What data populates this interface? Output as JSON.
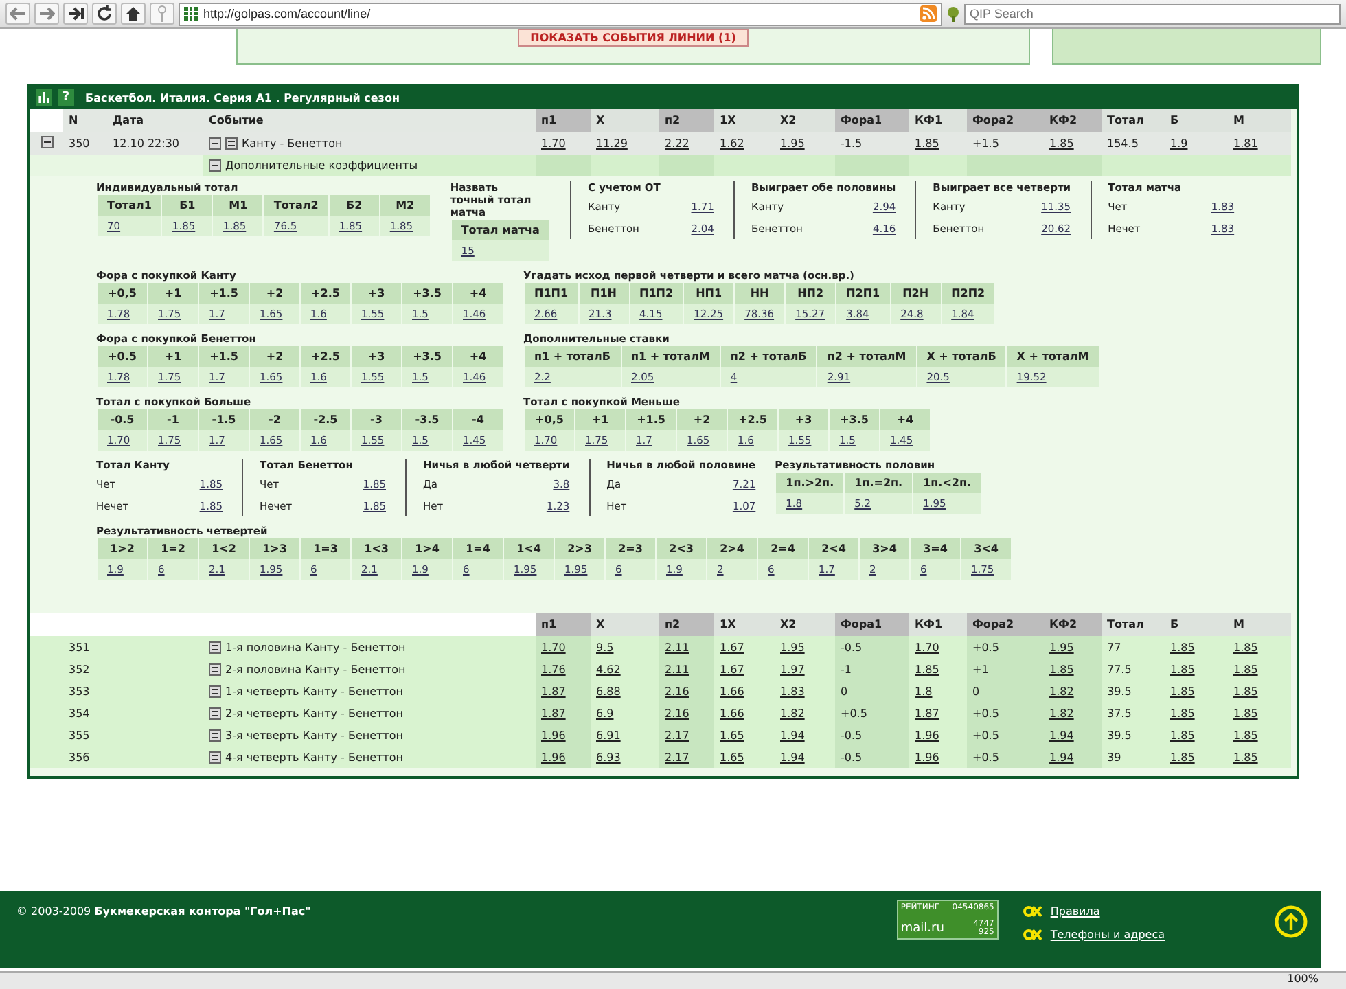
{
  "browser": {
    "url": "http://golpas.com/account/line/",
    "search_placeholder": "QIP Search",
    "zoom": "100%"
  },
  "banner": {
    "button": "ПОКАЗАТЬ СОБЫТИЯ ЛИНИИ (1)"
  },
  "panel": {
    "help": "?",
    "title": "Баскетбол. Италия. Серия А1 . Регулярный сезон"
  },
  "table": {
    "columns": [
      "N",
      "Дата",
      "Событие",
      "п1",
      "Х",
      "п2",
      "1Х",
      "Х2",
      "Фора1",
      "КФ1",
      "Фора2",
      "КФ2",
      "Тотал",
      "Б",
      "М"
    ],
    "rows": [
      {
        "n": "350",
        "date": "12.10 22:30",
        "event": "Канту - Бенеттон",
        "odds": [
          "1.70",
          "11.29",
          "2.22",
          "1.62",
          "1.95",
          "-1.5",
          "1.85",
          "+1.5",
          "1.85",
          "154.5",
          "1.9",
          "1.81"
        ]
      }
    ],
    "extra_label": "Дополнительные коэффициенты"
  },
  "extras": [
    [
      {
        "kind": "grid",
        "title": "Индивидуальный тотал",
        "headers": [
          "Тотал1",
          "Б1",
          "М1",
          "Тотал2",
          "Б2",
          "М2"
        ],
        "values": [
          "70",
          "1.85",
          "1.85",
          "76.5",
          "1.85",
          "1.85"
        ]
      },
      {
        "kind": "grid",
        "title": "Назвать точный тотал матча",
        "headers": [
          "Тотал матча"
        ],
        "values": [
          "15"
        ]
      },
      {
        "kind": "pairs",
        "title": "С учетом ОТ",
        "rows": [
          {
            "label": "Канту",
            "value": "1.71"
          },
          {
            "label": "Бенеттон",
            "value": "2.04"
          }
        ]
      },
      {
        "kind": "pairs",
        "title": "Выиграет обе половины",
        "rows": [
          {
            "label": "Канту",
            "value": "2.94"
          },
          {
            "label": "Бенеттон",
            "value": "4.16"
          }
        ]
      },
      {
        "kind": "pairs",
        "title": "Выиграет все четверти",
        "rows": [
          {
            "label": "Канту",
            "value": "11.35"
          },
          {
            "label": "Бенеттон",
            "value": "20.62"
          }
        ]
      },
      {
        "kind": "pairs",
        "title": "Тотал матча",
        "rows": [
          {
            "label": "Чет",
            "value": "1.83"
          },
          {
            "label": "Нечет",
            "value": "1.83"
          }
        ]
      }
    ],
    [
      {
        "kind": "grid",
        "title": "Фора с покупкой Канту",
        "headers": [
          "+0,5",
          "+1",
          "+1.5",
          "+2",
          "+2.5",
          "+3",
          "+3.5",
          "+4"
        ],
        "values": [
          "1.78",
          "1.75",
          "1.7",
          "1.65",
          "1.6",
          "1.55",
          "1.5",
          "1.46"
        ]
      },
      {
        "kind": "grid",
        "title": "Угадать исход первой четверти и всего матча (осн.вр.)",
        "headers": [
          "П1П1",
          "П1Н",
          "П1П2",
          "НП1",
          "НН",
          "НП2",
          "П2П1",
          "П2Н",
          "П2П2"
        ],
        "values": [
          "2.66",
          "21.3",
          "4.15",
          "12.25",
          "78.36",
          "15.27",
          "3.84",
          "24.8",
          "1.84"
        ]
      }
    ],
    [
      {
        "kind": "grid",
        "title": "Фора с покупкой Бенеттон",
        "headers": [
          "+0.5",
          "+1",
          "+1.5",
          "+2",
          "+2.5",
          "+3",
          "+3.5",
          "+4"
        ],
        "values": [
          "1.78",
          "1.75",
          "1.7",
          "1.65",
          "1.6",
          "1.55",
          "1.5",
          "1.46"
        ]
      },
      {
        "kind": "grid",
        "title": "Дополнительные ставки",
        "headers": [
          "п1 + тоталБ",
          "п1 + тоталМ",
          "п2 + тоталБ",
          "п2 + тоталМ",
          "Х + тоталБ",
          "Х + тоталМ"
        ],
        "values": [
          "2.2",
          "2.05",
          "4",
          "2.91",
          "20.5",
          "19.52"
        ]
      }
    ],
    [
      {
        "kind": "grid",
        "title": "Тотал с покупкой Больше",
        "headers": [
          "-0.5",
          "-1",
          "-1.5",
          "-2",
          "-2.5",
          "-3",
          "-3.5",
          "-4"
        ],
        "values": [
          "1.70",
          "1.75",
          "1.7",
          "1.65",
          "1.6",
          "1.55",
          "1.5",
          "1.45"
        ]
      },
      {
        "kind": "grid",
        "title": "Тотал с покупкой Меньше",
        "headers": [
          "+0,5",
          "+1",
          "+1.5",
          "+2",
          "+2.5",
          "+3",
          "+3.5",
          "+4"
        ],
        "values": [
          "1.70",
          "1.75",
          "1.7",
          "1.65",
          "1.6",
          "1.55",
          "1.5",
          "1.45"
        ]
      }
    ],
    [
      {
        "kind": "pairs",
        "title": "Тотал Канту",
        "rows": [
          {
            "label": "Чет",
            "value": "1.85"
          },
          {
            "label": "Нечет",
            "value": "1.85"
          }
        ]
      },
      {
        "kind": "pairs",
        "title": "Тотал Бенеттон",
        "rows": [
          {
            "label": "Чет",
            "value": "1.85"
          },
          {
            "label": "Нечет",
            "value": "1.85"
          }
        ]
      },
      {
        "kind": "pairs",
        "title": "Ничья в любой четверти",
        "rows": [
          {
            "label": "Да",
            "value": "3.8"
          },
          {
            "label": "Нет",
            "value": "1.23"
          }
        ]
      },
      {
        "kind": "pairs",
        "title": "Ничья в любой половине",
        "rows": [
          {
            "label": "Да",
            "value": "7.21"
          },
          {
            "label": "Нет",
            "value": "1.07"
          }
        ]
      },
      {
        "kind": "grid",
        "title": "Результативность половин",
        "headers": [
          "1п.>2п.",
          "1п.=2п.",
          "1п.<2п."
        ],
        "values": [
          "1.8",
          "5.2",
          "1.95"
        ]
      }
    ],
    [
      {
        "kind": "grid",
        "title": "Результативность четвертей",
        "headers": [
          "1>2",
          "1=2",
          "1<2",
          "1>3",
          "1=3",
          "1<3",
          "1>4",
          "1=4",
          "1<4",
          "2>3",
          "2=3",
          "2<3",
          "2>4",
          "2=4",
          "2<4",
          "3>4",
          "3=4",
          "3<4"
        ],
        "values": [
          "1.9",
          "6",
          "2.1",
          "1.95",
          "6",
          "2.1",
          "1.9",
          "6",
          "1.95",
          "1.95",
          "6",
          "1.9",
          "2",
          "6",
          "1.7",
          "2",
          "6",
          "1.75"
        ]
      }
    ]
  ],
  "sub_table": {
    "columns": [
      "п1",
      "Х",
      "п2",
      "1Х",
      "Х2",
      "Фора1",
      "КФ1",
      "Фора2",
      "КФ2",
      "Тотал",
      "Б",
      "М"
    ],
    "rows": [
      {
        "n": "351",
        "event": "1-я половина Канту - Бенеттон",
        "odds": [
          "1.70",
          "9.5",
          "2.11",
          "1.67",
          "1.95",
          "-0.5",
          "1.70",
          "+0.5",
          "1.95",
          "77",
          "1.85",
          "1.85"
        ]
      },
      {
        "n": "352",
        "event": "2-я половина Канту - Бенеттон",
        "odds": [
          "1.76",
          "4.62",
          "2.11",
          "1.67",
          "1.97",
          "-1",
          "1.85",
          "+1",
          "1.85",
          "77.5",
          "1.85",
          "1.85"
        ]
      },
      {
        "n": "353",
        "event": "1-я четверть Канту - Бенеттон",
        "odds": [
          "1.87",
          "6.88",
          "2.16",
          "1.66",
          "1.83",
          "0",
          "1.8",
          "0",
          "1.82",
          "39.5",
          "1.85",
          "1.85"
        ]
      },
      {
        "n": "354",
        "event": "2-я четверть Канту - Бенеттон",
        "odds": [
          "1.87",
          "6.9",
          "2.16",
          "1.66",
          "1.82",
          "+0.5",
          "1.87",
          "+0.5",
          "1.82",
          "37.5",
          "1.85",
          "1.85"
        ]
      },
      {
        "n": "355",
        "event": "3-я четверть Канту - Бенеттон",
        "odds": [
          "1.96",
          "6.91",
          "2.17",
          "1.65",
          "1.94",
          "-0.5",
          "1.96",
          "+0.5",
          "1.94",
          "39.5",
          "1.85",
          "1.85"
        ]
      },
      {
        "n": "356",
        "event": "4-я четверть Канту - Бенеттон",
        "odds": [
          "1.96",
          "6.93",
          "2.17",
          "1.65",
          "1.94",
          "-0.5",
          "1.96",
          "+0.5",
          "1.94",
          "39",
          "1.85",
          "1.85"
        ]
      }
    ]
  },
  "footer": {
    "copyright": "© 2003-2009 **Букмекерская контора \"Гол+Пас\"**",
    "counter": {
      "label": "РЕЙТИНГ",
      "id": "04540865",
      "brand": "mail.ru",
      "hits": "4747",
      "hosts": "925"
    },
    "links": [
      "Правила",
      "Телефоны и адреса"
    ]
  }
}
